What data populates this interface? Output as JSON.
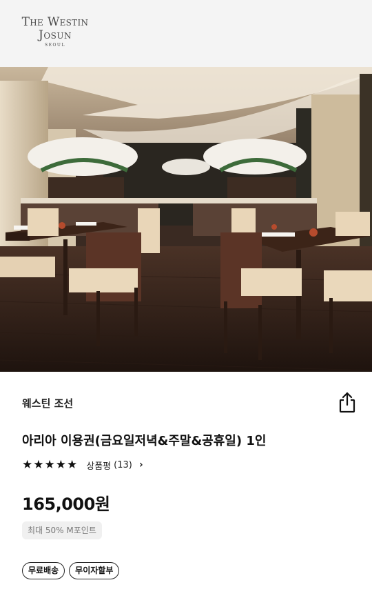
{
  "header": {
    "logo_line1": "The Westin",
    "logo_line2": "Josun",
    "logo_line3": "SEOUL"
  },
  "hero": {
    "image_name": "restaurant-interior-image"
  },
  "product": {
    "brand": "웨스틴 조선",
    "title": "아리아 이용권(금요일저녁&주말&공휴일) 1인",
    "rating": {
      "stars": 5,
      "star_glyph": "★",
      "review_label": "상품평",
      "review_count": "(13)",
      "chevron": "›"
    },
    "price": "165,000원",
    "point_badge": "최대 50% M포인트",
    "tags": [
      "무료배송",
      "무이자할부"
    ]
  },
  "icons": {
    "share": "share-icon",
    "chevron": "chevron-right-icon",
    "star": "star-icon"
  }
}
